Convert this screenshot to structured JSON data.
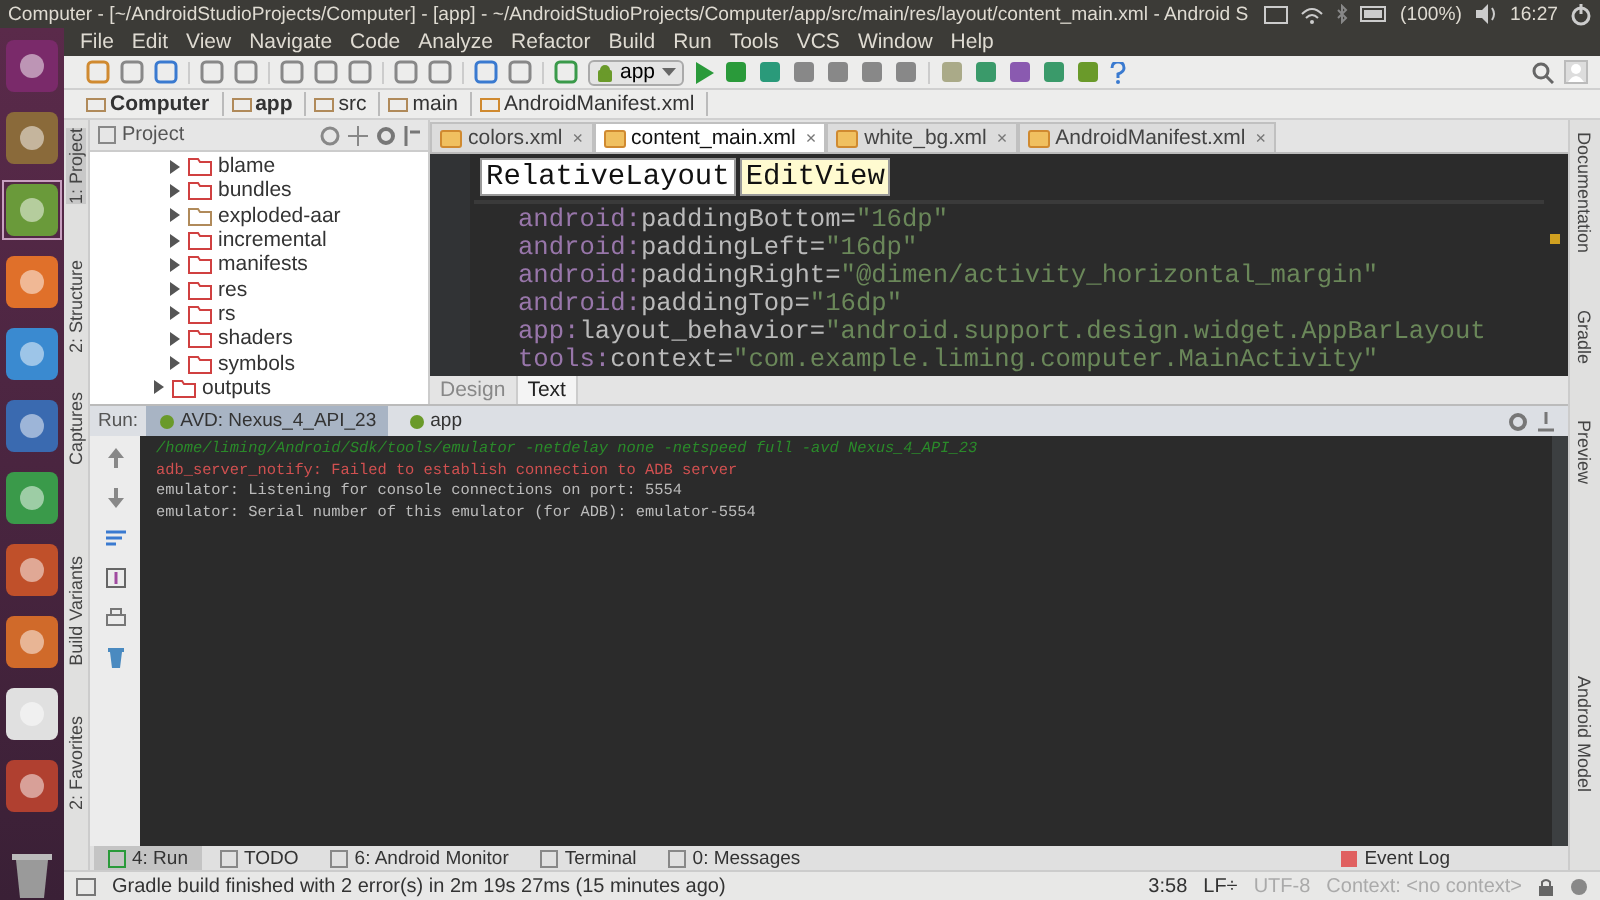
{
  "window": {
    "title": "Computer - [~/AndroidStudioProjects/Computer] - [app] - ~/AndroidStudioProjects/Computer/app/src/main/res/layout/content_main.xml - Android S",
    "battery": "(100%)",
    "clock": "16:27"
  },
  "menu": [
    "File",
    "Edit",
    "View",
    "Navigate",
    "Code",
    "Analyze",
    "Refactor",
    "Build",
    "Run",
    "Tools",
    "VCS",
    "Window",
    "Help"
  ],
  "toolbar": {
    "config": "app"
  },
  "breadcrumb": [
    "Computer",
    "app",
    "src",
    "main",
    "AndroidManifest.xml"
  ],
  "left_strip": [
    {
      "label": "1: Project",
      "selected": true
    },
    {
      "label": "2: Structure",
      "selected": false
    },
    {
      "label": "Captures",
      "selected": false
    },
    {
      "label": "Build Variants",
      "selected": false
    },
    {
      "label": "2: Favorites",
      "selected": false
    }
  ],
  "right_strip": [
    "Documentation",
    "Gradle",
    "Preview",
    "Android Model"
  ],
  "project": {
    "title": "Project",
    "tree": [
      {
        "children": [
          {
            "label": "blame",
            "expanded": false,
            "excluded": true
          },
          {
            "label": "bundles",
            "expanded": false,
            "excluded": true
          },
          {
            "label": "exploded-aar",
            "expanded": false,
            "excluded": false
          },
          {
            "label": "incremental",
            "expanded": false,
            "excluded": true
          },
          {
            "label": "manifests",
            "expanded": false,
            "excluded": true
          },
          {
            "label": "res",
            "expanded": false,
            "excluded": true
          },
          {
            "label": "rs",
            "expanded": false,
            "excluded": true
          },
          {
            "label": "shaders",
            "expanded": false,
            "excluded": true
          },
          {
            "label": "symbols",
            "expanded": false,
            "excluded": true
          }
        ]
      },
      {
        "label": "outputs",
        "expanded": false,
        "excluded": true
      }
    ]
  },
  "editor": {
    "tabs": [
      {
        "label": "colors.xml",
        "selected": false,
        "close": "×"
      },
      {
        "label": "content_main.xml",
        "selected": true,
        "close": "×"
      },
      {
        "label": "white_bg.xml",
        "selected": false,
        "close": "×"
      },
      {
        "label": "AndroidManifest.xml",
        "selected": false,
        "close": "×"
      }
    ],
    "tags": [
      {
        "label": "RelativeLayout",
        "selected": false
      },
      {
        "label": "EditView",
        "selected": true
      }
    ],
    "lines": [
      {
        "ns": "android:",
        "attr": "paddingBottom=",
        "value": "\"16dp\""
      },
      {
        "ns": "android:",
        "attr": "paddingLeft=",
        "value": "\"16dp\""
      },
      {
        "ns": "android:",
        "attr": "paddingRight=",
        "value": "\"@dimen/activity_horizontal_margin\""
      },
      {
        "ns": "android:",
        "attr": "paddingTop=",
        "value": "\"16dp\""
      },
      {
        "ns": "app:",
        "attr": "layout_behavior=",
        "value": "\"android.support.design.widget.AppBarLayout"
      },
      {
        "ns": "tools:",
        "attr": "context=",
        "value": "\"com.example.liming.computer.MainActivity\""
      }
    ],
    "modes": [
      {
        "label": "Design",
        "selected": false
      },
      {
        "label": "Text",
        "selected": true
      }
    ]
  },
  "run": {
    "label": "Run:",
    "tabs": [
      {
        "label": "AVD: Nexus_4_API_23",
        "selected": true
      },
      {
        "label": "app",
        "selected": false
      }
    ],
    "console": [
      {
        "kind": "command",
        "text": "/home/liming/Android/Sdk/tools/emulator -netdelay none -netspeed full -avd Nexus_4_API_23"
      },
      {
        "kind": "error",
        "text": "adb_server_notify: Failed to establish connection to ADB server"
      },
      {
        "kind": "info",
        "text": "emulator: Listening for console connections on port: 5554"
      },
      {
        "kind": "info",
        "text": "emulator: Serial number of this emulator (for ADB): emulator-5554"
      }
    ]
  },
  "tool_tabs": [
    {
      "label": "4: Run",
      "selected": true
    },
    {
      "label": "TODO",
      "selected": false
    },
    {
      "label": "6: Android Monitor",
      "selected": false
    },
    {
      "label": "Terminal",
      "selected": false
    },
    {
      "label": "0: Messages",
      "selected": false
    }
  ],
  "event_log": "Event Log",
  "status_bar": {
    "message": "Gradle build finished with 2 error(s) in 2m 19s 27ms (15 minutes ago)",
    "position": "3:58",
    "line_sep": "LF÷",
    "encoding": "UTF-8",
    "context": "Context: <no context>"
  }
}
